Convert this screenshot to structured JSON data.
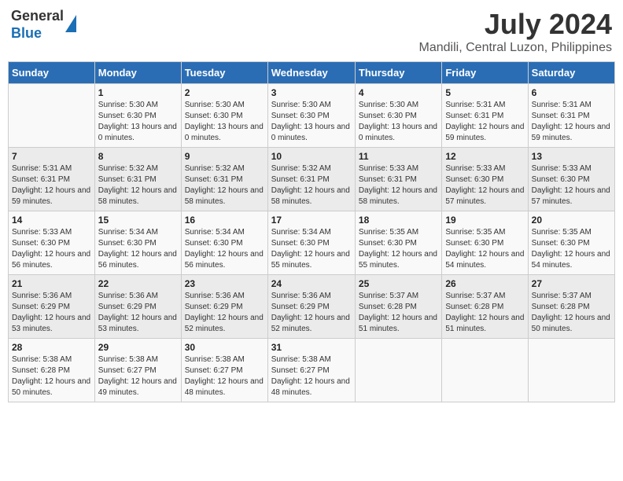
{
  "header": {
    "logo_line1": "General",
    "logo_line2": "Blue",
    "month_year": "July 2024",
    "location": "Mandili, Central Luzon, Philippines"
  },
  "days_of_week": [
    "Sunday",
    "Monday",
    "Tuesday",
    "Wednesday",
    "Thursday",
    "Friday",
    "Saturday"
  ],
  "weeks": [
    [
      {
        "day": "",
        "sunrise": "",
        "sunset": "",
        "daylight": ""
      },
      {
        "day": "1",
        "sunrise": "Sunrise: 5:30 AM",
        "sunset": "Sunset: 6:30 PM",
        "daylight": "Daylight: 13 hours and 0 minutes."
      },
      {
        "day": "2",
        "sunrise": "Sunrise: 5:30 AM",
        "sunset": "Sunset: 6:30 PM",
        "daylight": "Daylight: 13 hours and 0 minutes."
      },
      {
        "day": "3",
        "sunrise": "Sunrise: 5:30 AM",
        "sunset": "Sunset: 6:30 PM",
        "daylight": "Daylight: 13 hours and 0 minutes."
      },
      {
        "day": "4",
        "sunrise": "Sunrise: 5:30 AM",
        "sunset": "Sunset: 6:30 PM",
        "daylight": "Daylight: 13 hours and 0 minutes."
      },
      {
        "day": "5",
        "sunrise": "Sunrise: 5:31 AM",
        "sunset": "Sunset: 6:31 PM",
        "daylight": "Daylight: 12 hours and 59 minutes."
      },
      {
        "day": "6",
        "sunrise": "Sunrise: 5:31 AM",
        "sunset": "Sunset: 6:31 PM",
        "daylight": "Daylight: 12 hours and 59 minutes."
      }
    ],
    [
      {
        "day": "7",
        "sunrise": "Sunrise: 5:31 AM",
        "sunset": "Sunset: 6:31 PM",
        "daylight": "Daylight: 12 hours and 59 minutes."
      },
      {
        "day": "8",
        "sunrise": "Sunrise: 5:32 AM",
        "sunset": "Sunset: 6:31 PM",
        "daylight": "Daylight: 12 hours and 58 minutes."
      },
      {
        "day": "9",
        "sunrise": "Sunrise: 5:32 AM",
        "sunset": "Sunset: 6:31 PM",
        "daylight": "Daylight: 12 hours and 58 minutes."
      },
      {
        "day": "10",
        "sunrise": "Sunrise: 5:32 AM",
        "sunset": "Sunset: 6:31 PM",
        "daylight": "Daylight: 12 hours and 58 minutes."
      },
      {
        "day": "11",
        "sunrise": "Sunrise: 5:33 AM",
        "sunset": "Sunset: 6:31 PM",
        "daylight": "Daylight: 12 hours and 58 minutes."
      },
      {
        "day": "12",
        "sunrise": "Sunrise: 5:33 AM",
        "sunset": "Sunset: 6:30 PM",
        "daylight": "Daylight: 12 hours and 57 minutes."
      },
      {
        "day": "13",
        "sunrise": "Sunrise: 5:33 AM",
        "sunset": "Sunset: 6:30 PM",
        "daylight": "Daylight: 12 hours and 57 minutes."
      }
    ],
    [
      {
        "day": "14",
        "sunrise": "Sunrise: 5:33 AM",
        "sunset": "Sunset: 6:30 PM",
        "daylight": "Daylight: 12 hours and 56 minutes."
      },
      {
        "day": "15",
        "sunrise": "Sunrise: 5:34 AM",
        "sunset": "Sunset: 6:30 PM",
        "daylight": "Daylight: 12 hours and 56 minutes."
      },
      {
        "day": "16",
        "sunrise": "Sunrise: 5:34 AM",
        "sunset": "Sunset: 6:30 PM",
        "daylight": "Daylight: 12 hours and 56 minutes."
      },
      {
        "day": "17",
        "sunrise": "Sunrise: 5:34 AM",
        "sunset": "Sunset: 6:30 PM",
        "daylight": "Daylight: 12 hours and 55 minutes."
      },
      {
        "day": "18",
        "sunrise": "Sunrise: 5:35 AM",
        "sunset": "Sunset: 6:30 PM",
        "daylight": "Daylight: 12 hours and 55 minutes."
      },
      {
        "day": "19",
        "sunrise": "Sunrise: 5:35 AM",
        "sunset": "Sunset: 6:30 PM",
        "daylight": "Daylight: 12 hours and 54 minutes."
      },
      {
        "day": "20",
        "sunrise": "Sunrise: 5:35 AM",
        "sunset": "Sunset: 6:30 PM",
        "daylight": "Daylight: 12 hours and 54 minutes."
      }
    ],
    [
      {
        "day": "21",
        "sunrise": "Sunrise: 5:36 AM",
        "sunset": "Sunset: 6:29 PM",
        "daylight": "Daylight: 12 hours and 53 minutes."
      },
      {
        "day": "22",
        "sunrise": "Sunrise: 5:36 AM",
        "sunset": "Sunset: 6:29 PM",
        "daylight": "Daylight: 12 hours and 53 minutes."
      },
      {
        "day": "23",
        "sunrise": "Sunrise: 5:36 AM",
        "sunset": "Sunset: 6:29 PM",
        "daylight": "Daylight: 12 hours and 52 minutes."
      },
      {
        "day": "24",
        "sunrise": "Sunrise: 5:36 AM",
        "sunset": "Sunset: 6:29 PM",
        "daylight": "Daylight: 12 hours and 52 minutes."
      },
      {
        "day": "25",
        "sunrise": "Sunrise: 5:37 AM",
        "sunset": "Sunset: 6:28 PM",
        "daylight": "Daylight: 12 hours and 51 minutes."
      },
      {
        "day": "26",
        "sunrise": "Sunrise: 5:37 AM",
        "sunset": "Sunset: 6:28 PM",
        "daylight": "Daylight: 12 hours and 51 minutes."
      },
      {
        "day": "27",
        "sunrise": "Sunrise: 5:37 AM",
        "sunset": "Sunset: 6:28 PM",
        "daylight": "Daylight: 12 hours and 50 minutes."
      }
    ],
    [
      {
        "day": "28",
        "sunrise": "Sunrise: 5:38 AM",
        "sunset": "Sunset: 6:28 PM",
        "daylight": "Daylight: 12 hours and 50 minutes."
      },
      {
        "day": "29",
        "sunrise": "Sunrise: 5:38 AM",
        "sunset": "Sunset: 6:27 PM",
        "daylight": "Daylight: 12 hours and 49 minutes."
      },
      {
        "day": "30",
        "sunrise": "Sunrise: 5:38 AM",
        "sunset": "Sunset: 6:27 PM",
        "daylight": "Daylight: 12 hours and 48 minutes."
      },
      {
        "day": "31",
        "sunrise": "Sunrise: 5:38 AM",
        "sunset": "Sunset: 6:27 PM",
        "daylight": "Daylight: 12 hours and 48 minutes."
      },
      {
        "day": "",
        "sunrise": "",
        "sunset": "",
        "daylight": ""
      },
      {
        "day": "",
        "sunrise": "",
        "sunset": "",
        "daylight": ""
      },
      {
        "day": "",
        "sunrise": "",
        "sunset": "",
        "daylight": ""
      }
    ]
  ]
}
